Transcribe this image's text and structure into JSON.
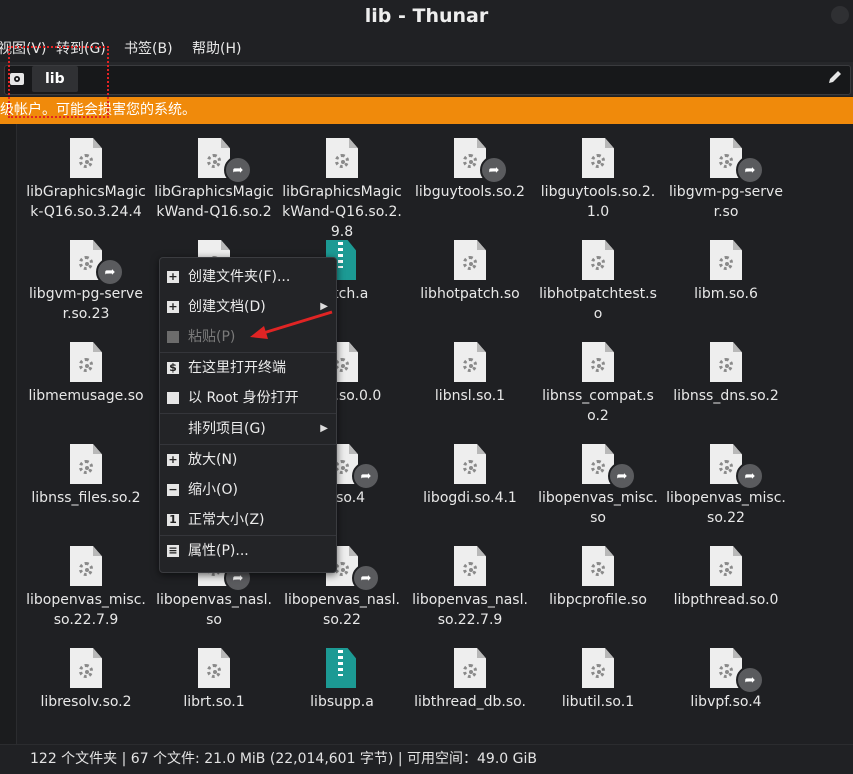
{
  "window": {
    "title": "lib - Thunar"
  },
  "menu": [
    "视图(V)",
    "转到(G)",
    "书签(B)",
    "帮助(H)"
  ],
  "location": {
    "current_folder": "lib"
  },
  "warning": "级帐户。可能会损害您的系统。",
  "files": [
    {
      "name": "libGraphicsMagick-Q16.so.3.24.4",
      "type": "lib",
      "link": false
    },
    {
      "name": "libGraphicsMagickWand-Q16.so.2",
      "type": "lib",
      "link": true
    },
    {
      "name": "libGraphicsMagickWand-Q16.so.2.9.8",
      "type": "lib",
      "link": false
    },
    {
      "name": "libguytools.so.2",
      "type": "lib",
      "link": true
    },
    {
      "name": "libguytools.so.2.1.0",
      "type": "lib",
      "link": false
    },
    {
      "name": "libgvm-pg-server.so",
      "type": "lib",
      "link": true
    },
    {
      "name": "libgvm-pg-server.so.23",
      "type": "lib",
      "link": true
    },
    {
      "name": "",
      "type": "lib",
      "link": false
    },
    {
      "name": "patch.a",
      "type": "archive",
      "link": false
    },
    {
      "name": "libhotpatch.so",
      "type": "lib",
      "link": false
    },
    {
      "name": "libhotpatchtest.so",
      "type": "lib",
      "link": false
    },
    {
      "name": "libm.so.6",
      "type": "lib",
      "link": false
    },
    {
      "name": "libmemusage.so",
      "type": "lib",
      "link": false
    },
    {
      "name": "",
      "type": "lib",
      "link": false
    },
    {
      "name": "dfalt.so.0.0",
      "type": "lib",
      "link": false
    },
    {
      "name": "libnsl.so.1",
      "type": "lib",
      "link": false
    },
    {
      "name": "libnss_compat.so.2",
      "type": "lib",
      "link": false
    },
    {
      "name": "libnss_dns.so.2",
      "type": "lib",
      "link": false
    },
    {
      "name": "libnss_files.so.2",
      "type": "lib",
      "link": false
    },
    {
      "name": "l",
      "type": "lib",
      "link": false
    },
    {
      "name": "di.so.4",
      "type": "lib",
      "link": true
    },
    {
      "name": "libogdi.so.4.1",
      "type": "lib",
      "link": false
    },
    {
      "name": "libopenvas_misc.so",
      "type": "lib",
      "link": true
    },
    {
      "name": "libopenvas_misc.so.22",
      "type": "lib",
      "link": true
    },
    {
      "name": "libopenvas_misc.so.22.7.9",
      "type": "lib",
      "link": false
    },
    {
      "name": "libopenvas_nasl.so",
      "type": "lib",
      "link": true
    },
    {
      "name": "libopenvas_nasl.so.22",
      "type": "lib",
      "link": true
    },
    {
      "name": "libopenvas_nasl.so.22.7.9",
      "type": "lib",
      "link": false
    },
    {
      "name": "libpcprofile.so",
      "type": "lib",
      "link": false
    },
    {
      "name": "libpthread.so.0",
      "type": "lib",
      "link": false
    },
    {
      "name": "libresolv.so.2",
      "type": "lib",
      "link": false
    },
    {
      "name": "librt.so.1",
      "type": "lib",
      "link": false
    },
    {
      "name": "libsupp.a",
      "type": "archive",
      "link": false
    },
    {
      "name": "libthread_db.so.",
      "type": "lib",
      "link": false
    },
    {
      "name": "libutil.so.1",
      "type": "lib",
      "link": false
    },
    {
      "name": "libvpf.so.4",
      "type": "lib",
      "link": true
    }
  ],
  "context_menu": {
    "items": [
      {
        "label": "创建文件夹(F)...",
        "icon": "folder-new-icon",
        "submenu": false,
        "disabled": false
      },
      {
        "label": "创建文档(D)",
        "icon": "document-new-icon",
        "submenu": true,
        "disabled": false
      },
      {
        "label": "粘贴(P)",
        "icon": "paste-icon",
        "submenu": false,
        "disabled": true
      },
      {
        "label": "在这里打开终端",
        "icon": "terminal-icon",
        "submenu": false,
        "disabled": false
      },
      {
        "label": "以 Root 身份打开",
        "icon": "folder-icon",
        "submenu": false,
        "disabled": false
      },
      {
        "label": "排列项目(G)",
        "icon": "",
        "submenu": true,
        "disabled": false
      },
      {
        "label": "放大(N)",
        "icon": "zoom-in-icon",
        "submenu": false,
        "disabled": false
      },
      {
        "label": "缩小(O)",
        "icon": "zoom-out-icon",
        "submenu": false,
        "disabled": false
      },
      {
        "label": "正常大小(Z)",
        "icon": "zoom-original-icon",
        "submenu": false,
        "disabled": false
      },
      {
        "label": "属性(P)...",
        "icon": "properties-icon",
        "submenu": false,
        "disabled": false
      }
    ]
  },
  "status": "122 个文件夹 | 67 个文件: 21.0 MiB (22,014,601 字节) | 可用空间：49.0 GiB",
  "colors": {
    "warning_bg": "#f08a0b",
    "annotation": "#e02424"
  }
}
